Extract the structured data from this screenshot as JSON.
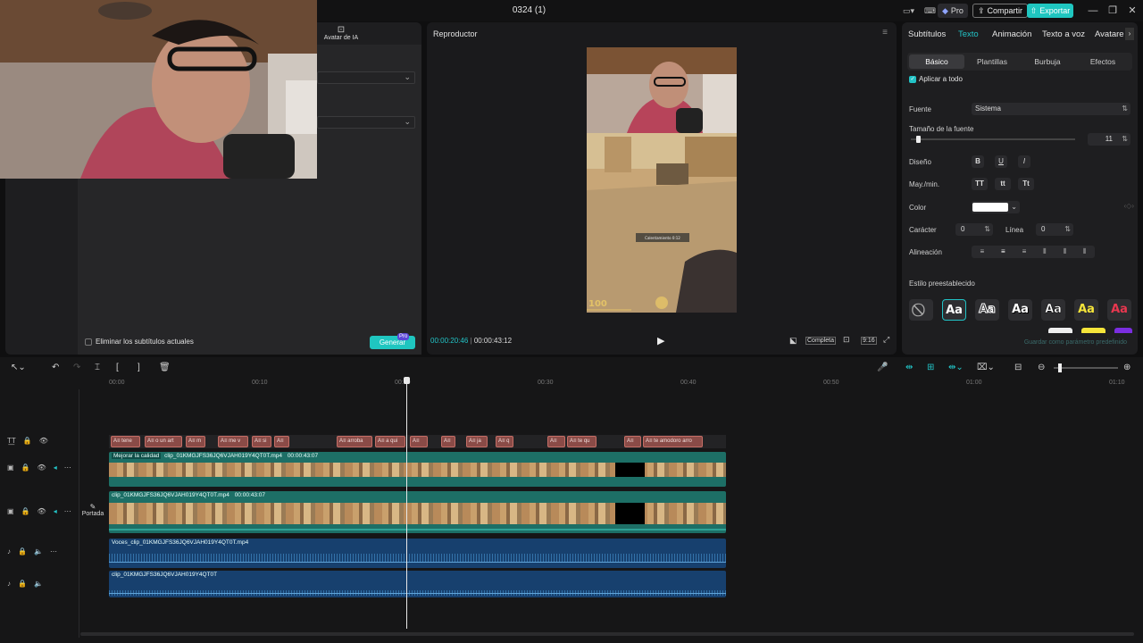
{
  "window": {
    "title": "0324 (1)",
    "pro_label": "Pro",
    "share_label": "Compartir",
    "export_label": "Exportar"
  },
  "left_panel": {
    "tab_ai_avatar": "Avatar de IA",
    "remove_subtitles_label": "Eliminar los subtítulos actuales",
    "generate_label": "Generar",
    "generate_badge": "Pro"
  },
  "player": {
    "title": "Reproductor",
    "current_time": "00:00:20:46",
    "total_time": "00:00:43:12",
    "full_label": "Completa",
    "ratio_label": "9:16",
    "hud_value": "100",
    "game_text": "Calentamiento 0:12"
  },
  "right_panel": {
    "tabs": [
      "Subtítulos",
      "Texto",
      "Animación",
      "Texto a voz",
      "Avatare"
    ],
    "active_tab": "Texto",
    "subtabs": [
      "Básico",
      "Plantillas",
      "Burbuja",
      "Efectos"
    ],
    "apply_all_label": "Aplicar a todo",
    "font_label": "Fuente",
    "font_value": "Sistema",
    "font_size_label": "Tamaño de la fuente",
    "font_size_value": "11",
    "design_label": "Diseño",
    "case_label": "May./min.",
    "case_options": [
      "TT",
      "tt",
      "Tt"
    ],
    "color_label": "Color",
    "char_label": "Carácter",
    "char_value": "0",
    "line_label": "Línea",
    "line_value": "0",
    "align_label": "Alineación",
    "preset_label": "Estilo preestablecido",
    "preset_tile_text": "Aa",
    "save_default_label": "Guardar como parámetro predefinido",
    "font_size_level": 0.03
  },
  "timeline": {
    "ruler": [
      "00:00",
      "00:10",
      "00:20",
      "00:30",
      "00:40",
      "00:50",
      "01:00",
      "01:10"
    ],
    "subtitle_chips": [
      "tene",
      "o un art",
      "m",
      "me v",
      "si",
      "",
      "arroba",
      "a qui",
      "",
      "",
      "ja",
      "q",
      "",
      "te qu",
      "",
      "te amodoro arro"
    ],
    "video_track_1": {
      "label": "Mejorar la calidad",
      "clip_name": "clip_01KMGJFS36JQ6VJAH019Y4QT0T.mp4",
      "duration": "00:00:43:07"
    },
    "video_track_2": {
      "clip_name": "clip_01KMGJFS36JQ6VJAH019Y4QT0T.mp4",
      "duration": "00:00:43:07"
    },
    "cover_label": "Portada",
    "audio_track_1": {
      "clip_name": "Voces_clip_01KMGJFS36JQ6VJAH019Y4QT0T.mp4"
    },
    "audio_track_2": {
      "clip_name": "clip_01KMGJFS36JQ6VJAH019Y4QT0T"
    }
  },
  "colors": {
    "accent": "#22c3c6",
    "export_bg": "#1fc6c0",
    "subtitle_chip": "#8a4b47",
    "video_clip": "#1d6f66",
    "audio_clip": "#17406e",
    "hud_gold": "#e3c267"
  }
}
